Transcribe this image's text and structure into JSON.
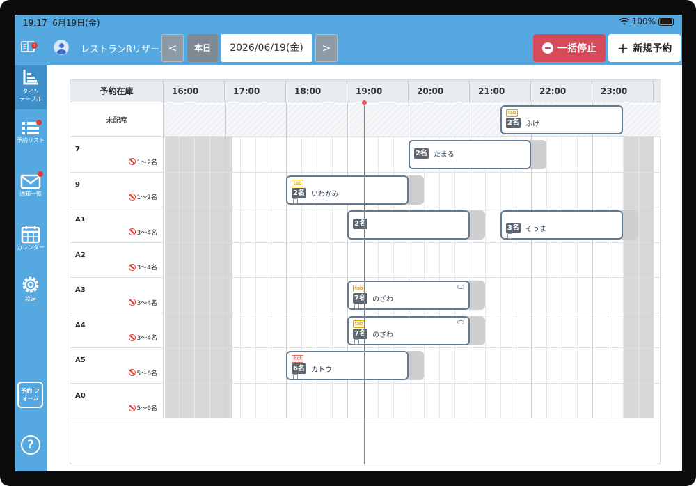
{
  "status_bar": {
    "time": "19:17",
    "date": "6月19日(金)",
    "battery": "100%"
  },
  "header": {
    "store_name": "レストランRリザー...",
    "prev_label": "<",
    "today_label": "本日",
    "date": "2026/06/19(金)",
    "next_label": ">",
    "stop_label": "一括停止",
    "new_label": "新規予約",
    "notice_badge": "!"
  },
  "sidebar": {
    "items": [
      {
        "label": "タイム テーブル",
        "icon": "timetable-icon",
        "active": true
      },
      {
        "label": "予約リスト",
        "icon": "list-icon",
        "badge": true
      },
      {
        "label": "通知一覧",
        "icon": "mail-icon",
        "badge": true
      },
      {
        "label": "カレンダー",
        "icon": "calendar-icon"
      },
      {
        "label": "設定",
        "icon": "gear-icon"
      }
    ],
    "form_label": "予約 フォーム",
    "help_label": "?"
  },
  "timetable": {
    "header_label": "予約在庫",
    "hours": [
      "16:00",
      "17:00",
      "18:00",
      "19:00",
      "20:00",
      "21:00",
      "22:00",
      "23:00"
    ],
    "current_time": "19:17",
    "unassigned_label": "未配席",
    "tables": [
      {
        "name": "7",
        "capacity": "1〜2名"
      },
      {
        "name": "9",
        "capacity": "1〜2名"
      },
      {
        "name": "A1",
        "capacity": "3〜4名"
      },
      {
        "name": "A2",
        "capacity": "3〜4名"
      },
      {
        "name": "A3",
        "capacity": "3〜4名"
      },
      {
        "name": "A4",
        "capacity": "3〜4名"
      },
      {
        "name": "A5",
        "capacity": "5〜6名"
      },
      {
        "name": "A0",
        "capacity": "5〜6名"
      }
    ],
    "reservations": [
      {
        "row": "未配席",
        "start": "21:30",
        "end": "23:30",
        "people": "2名",
        "name": "ふけ",
        "tag": "tab"
      },
      {
        "row": "7",
        "start": "20:00",
        "end": "22:00",
        "people": "2名",
        "name": "たまる"
      },
      {
        "row": "9",
        "start": "18:00",
        "end": "20:00",
        "people": "2名",
        "name": "いわかみ",
        "tag": "tab",
        "memo": true
      },
      {
        "row": "A1",
        "start": "19:00",
        "end": "21:00",
        "people": "2名",
        "name": ""
      },
      {
        "row": "A1",
        "start": "21:30",
        "end": "23:30",
        "people": "3名",
        "name": "そうま",
        "memo": true
      },
      {
        "row": "A3",
        "start": "19:00",
        "end": "21:00",
        "people": "7名",
        "name": "のざわ",
        "tag": "tab",
        "memo": true,
        "link": true
      },
      {
        "row": "A4",
        "start": "19:00",
        "end": "21:00",
        "people": "7名",
        "name": "のざわ",
        "tag": "tab",
        "memo": true,
        "link": true
      },
      {
        "row": "A5",
        "start": "18:00",
        "end": "20:00",
        "people": "6名",
        "name": "カトウ",
        "tag": "hot",
        "memo": true
      }
    ]
  }
}
